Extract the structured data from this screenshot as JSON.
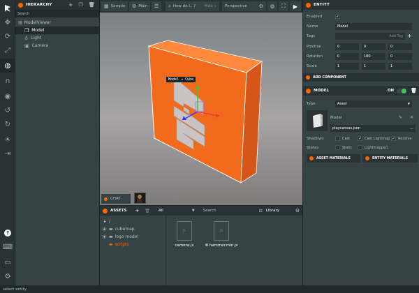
{
  "hierarchy": {
    "title": "HIERARCHY",
    "search_label": "Search",
    "items": [
      {
        "label": "ModelViewer"
      },
      {
        "label": "Model"
      },
      {
        "label": "Light"
      },
      {
        "label": "Camera"
      }
    ]
  },
  "topbar": {
    "scene_label": "Sample",
    "branch_label": "Main",
    "help_label": "How do I...?",
    "hide_label": "Hide »",
    "camera_label": "Perspective"
  },
  "viewport": {
    "tooltip": "Model → Cube"
  },
  "chat": {
    "label": "CHAT"
  },
  "assets": {
    "title": "ASSETS",
    "filter_label": "All",
    "search_label": "Search",
    "library_label": "Library",
    "tree": [
      {
        "label": "/"
      },
      {
        "label": "cubemap"
      },
      {
        "label": "logo model"
      },
      {
        "label": "scripts"
      }
    ],
    "files": [
      {
        "name": "camera.js",
        "type": "JS"
      },
      {
        "name": "hammer.min.js",
        "type": "JS"
      }
    ]
  },
  "entity": {
    "title": "ENTITY",
    "enabled_label": "Enabled",
    "name_label": "Name",
    "name_value": "Model",
    "tags_label": "Tags",
    "tags_placeholder": "Add Tag",
    "position_label": "Position",
    "position": [
      "0",
      "0",
      "0"
    ],
    "rotation_label": "Rotation",
    "rotation": [
      "0",
      "180",
      "0"
    ],
    "scale_label": "Scale",
    "scale": [
      "1",
      "1",
      "1"
    ],
    "add_component_label": "ADD COMPONENT"
  },
  "model": {
    "title": "MODEL",
    "on_label": "ON",
    "type_label": "Type",
    "type_value": "Asset",
    "model_label": "Model",
    "model_file": "playcanvas.json",
    "more_label": "...",
    "shadows_label": "Shadows",
    "cast_label": "Cast",
    "cast_lightmap_label": "Cast Lightmap",
    "receive_label": "Receive",
    "states_label": "States",
    "static_label": "Static",
    "lightmapped_label": "Lightmapped",
    "asset_materials_label": "ASSET MATERIALS",
    "entity_materials_label": "ENTITY MATERIALS"
  },
  "status": {
    "text": "select entity"
  },
  "colors": {
    "accent": "#ff6600",
    "panel": "#364346",
    "dark": "#293336"
  }
}
